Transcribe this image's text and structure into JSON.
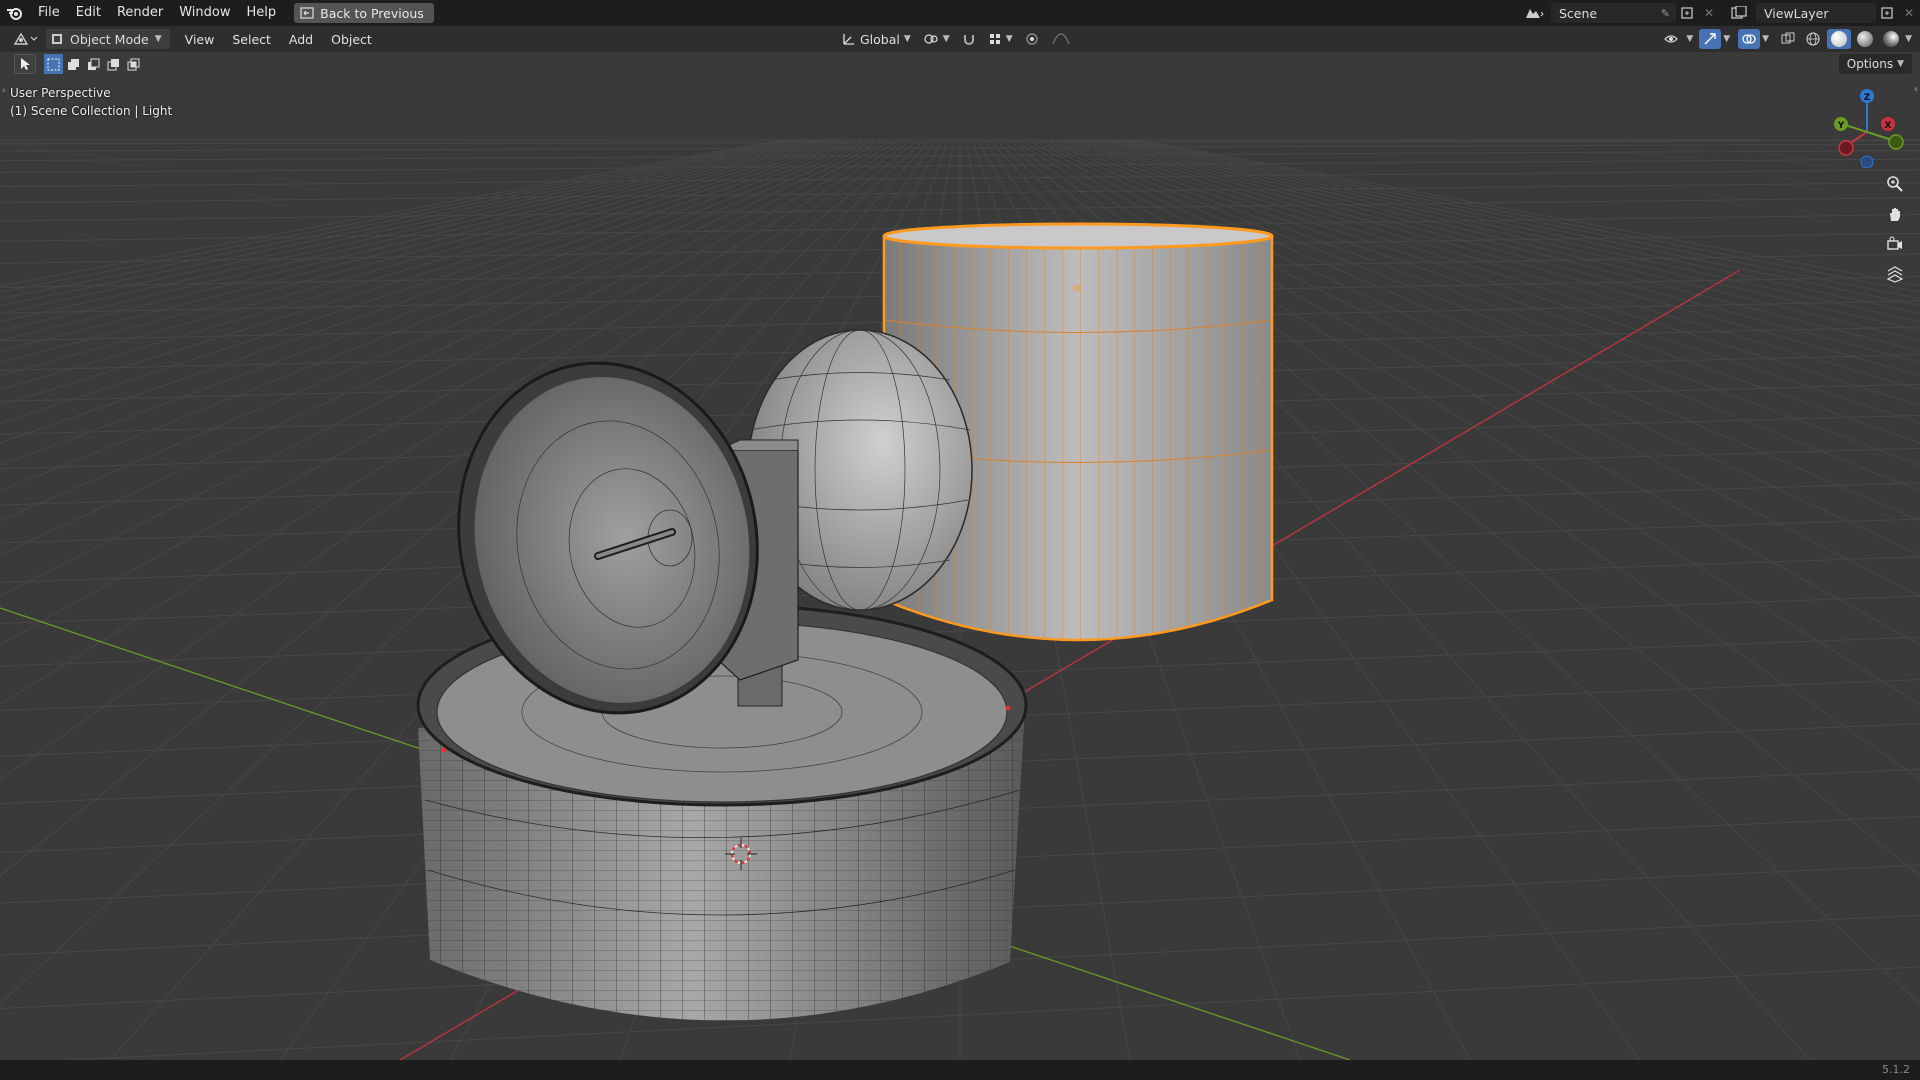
{
  "topbar": {
    "menus": [
      "File",
      "Edit",
      "Render",
      "Window",
      "Help"
    ],
    "back_label": "Back to Previous",
    "scene_name": "Scene",
    "view_layer": "ViewLayer"
  },
  "header": {
    "mode": "Object Mode",
    "menus": [
      "View",
      "Select",
      "Add",
      "Object"
    ],
    "orientation": "Global"
  },
  "toolrow": {
    "options_label": "Options"
  },
  "viewport": {
    "perspective_label": "User Perspective",
    "collection_label": "(1) Scene Collection | Light"
  },
  "gizmo": {
    "x_label": "X",
    "y_label": "Y",
    "z_label": "Z"
  },
  "status": {
    "version": "5.1.2"
  },
  "colors": {
    "accent": "#4772b3",
    "selection": "#ff9a1f",
    "axis_x": "#c8333f",
    "axis_y": "#6a9c23",
    "axis_z": "#2c78d4"
  }
}
